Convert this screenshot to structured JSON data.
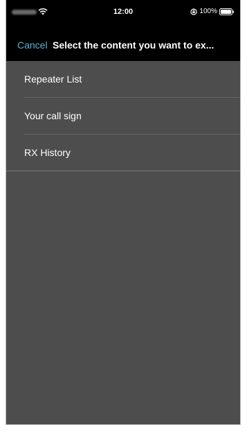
{
  "status_bar": {
    "time": "12:00",
    "battery": "100%",
    "icons": [
      "wifi-icon",
      "orientation-lock-icon",
      "battery-icon"
    ]
  },
  "nav": {
    "cancel_label": "Cancel",
    "title": "Select the content you want to ex..."
  },
  "list": {
    "items": [
      {
        "label": "Repeater List"
      },
      {
        "label": "Your call sign"
      },
      {
        "label": "RX History"
      }
    ]
  },
  "colors": {
    "accent": "#5ab4d2",
    "background": "#4d4d4d",
    "bar": "#000000",
    "text": "#ffffff"
  }
}
